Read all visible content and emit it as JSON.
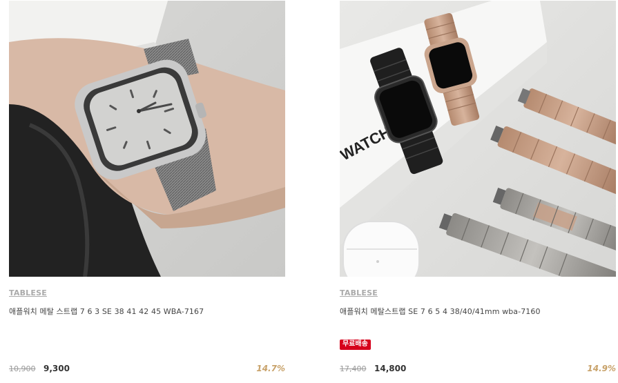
{
  "products": [
    {
      "image_alt": "metal mesh watch strap on wrist",
      "brand": "TABLESE",
      "name": "애플워치 메탈 스트랩 7 6 3 SE 38 41 42 45 WBA-7167",
      "badge": "",
      "original_price": "10,900",
      "sale_price": "9,300",
      "discount": "14.7%"
    },
    {
      "image_alt": "link bracelet watch straps",
      "brand": "TABLESE",
      "name": "애플워치 메탈스트랩 SE 7 6 5 4 38/40/41mm wba-7160",
      "badge": "무료배송",
      "original_price": "17,400",
      "sale_price": "14,800",
      "discount": "14.9%"
    }
  ],
  "colors": {
    "brand_text": "#aaaaaa",
    "badge_bg": "#d6001c",
    "discount_text": "#c8a26a"
  }
}
